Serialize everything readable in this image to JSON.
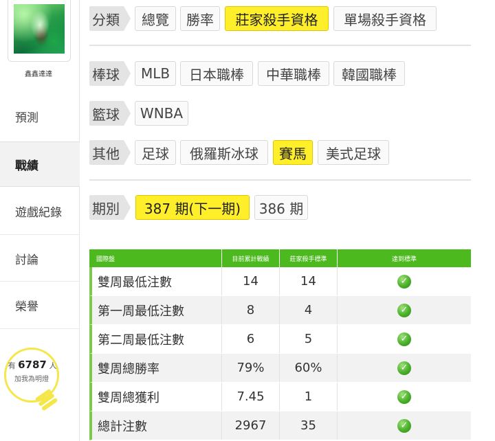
{
  "sidebar": {
    "username": "鑫鑫達達",
    "nav": [
      "預測",
      "戰績",
      "遊戲紀錄",
      "討論",
      "榮譽"
    ],
    "active_index": 1,
    "bulb": {
      "prefix": "有",
      "count": "6787",
      "suffix": "人",
      "line2": "加我為明燈",
      "color": "#f5e64a"
    }
  },
  "filters": {
    "category": {
      "label": "分類",
      "options": [
        "總覽",
        "勝率",
        "莊家殺手資格",
        "單場殺手資格"
      ],
      "active": "莊家殺手資格"
    },
    "baseball": {
      "label": "棒球",
      "options": [
        "MLB",
        "日本職棒",
        "中華職棒",
        "韓國職棒"
      ]
    },
    "basketball": {
      "label": "籃球",
      "options": [
        "WNBA"
      ]
    },
    "other": {
      "label": "其他",
      "options": [
        "足球",
        "俄羅斯冰球",
        "賽馬",
        "美式足球"
      ],
      "active": "賽馬"
    },
    "period": {
      "label": "期別",
      "options": [
        "387 期(下一期)",
        "386 期"
      ],
      "active": "387 期(下一期)"
    }
  },
  "table": {
    "headers": [
      "國際盤",
      "目前累計戰績",
      "莊家殺手標準",
      "達到標準"
    ],
    "rows": [
      {
        "name": "雙周最低注數",
        "current": "14",
        "standard": "14",
        "met": true
      },
      {
        "name": "第一周最低注數",
        "current": "8",
        "standard": "4",
        "met": true
      },
      {
        "name": "第二周最低注數",
        "current": "6",
        "standard": "5",
        "met": true
      },
      {
        "name": "雙周總勝率",
        "current": "79%",
        "standard": "60%",
        "met": true
      },
      {
        "name": "雙周總獲利",
        "current": "7.45",
        "standard": "1",
        "met": true
      },
      {
        "name": "總計注數",
        "current": "2967",
        "standard": "35",
        "met": true
      }
    ]
  },
  "colors": {
    "accent_green": "#4cba1f",
    "active_chip": "#ffef2a"
  }
}
